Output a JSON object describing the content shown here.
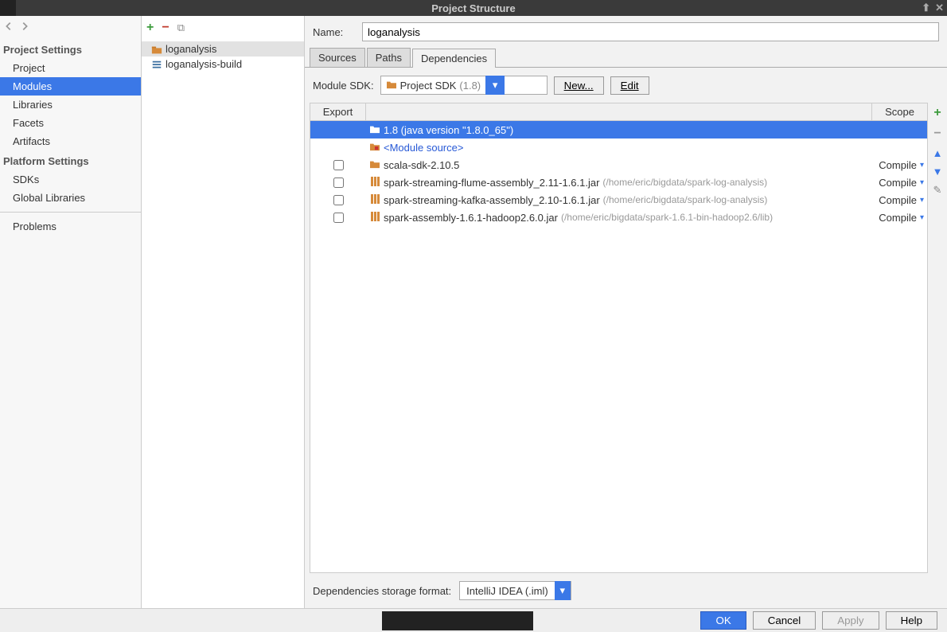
{
  "window": {
    "title": "Project Structure"
  },
  "leftnav": {
    "project_settings_title": "Project Settings",
    "platform_settings_title": "Platform Settings",
    "items_project": [
      "Project",
      "Modules",
      "Libraries",
      "Facets",
      "Artifacts"
    ],
    "items_platform": [
      "SDKs",
      "Global Libraries"
    ],
    "problems": "Problems"
  },
  "tree": {
    "items": [
      {
        "label": "loganalysis",
        "icon": "folder"
      },
      {
        "label": "loganalysis-build",
        "icon": "scala"
      }
    ]
  },
  "name_label": "Name:",
  "name_value": "loganalysis",
  "tabs": [
    "Sources",
    "Paths",
    "Dependencies"
  ],
  "sdk": {
    "label": "Module SDK:",
    "value_prefix": "Project SDK",
    "value_suffix": "(1.8)",
    "new_btn": "New...",
    "edit_btn": "Edit"
  },
  "deps_header": {
    "export": "Export",
    "scope": "Scope"
  },
  "deps": [
    {
      "export": null,
      "icon": "folder",
      "name": "1.8 (java version \"1.8.0_65\")",
      "path": "",
      "scope": "",
      "selected": true
    },
    {
      "export": null,
      "icon": "folder-red",
      "name": "<Module source>",
      "path": "",
      "scope": "",
      "link": true
    },
    {
      "export": false,
      "icon": "lib",
      "name": "scala-sdk-2.10.5",
      "path": "",
      "scope": "Compile"
    },
    {
      "export": false,
      "icon": "jar",
      "name": "spark-streaming-flume-assembly_2.11-1.6.1.jar",
      "path": "(/home/eric/bigdata/spark-log-analysis)",
      "scope": "Compile"
    },
    {
      "export": false,
      "icon": "jar",
      "name": "spark-streaming-kafka-assembly_2.10-1.6.1.jar",
      "path": "(/home/eric/bigdata/spark-log-analysis)",
      "scope": "Compile"
    },
    {
      "export": false,
      "icon": "jar",
      "name": "spark-assembly-1.6.1-hadoop2.6.0.jar",
      "path": "(/home/eric/bigdata/spark-1.6.1-bin-hadoop2.6/lib)",
      "scope": "Compile"
    }
  ],
  "storage": {
    "label": "Dependencies storage format:",
    "value": "IntelliJ IDEA (.iml)"
  },
  "footer": {
    "ok": "OK",
    "cancel": "Cancel",
    "apply": "Apply",
    "help": "Help"
  }
}
